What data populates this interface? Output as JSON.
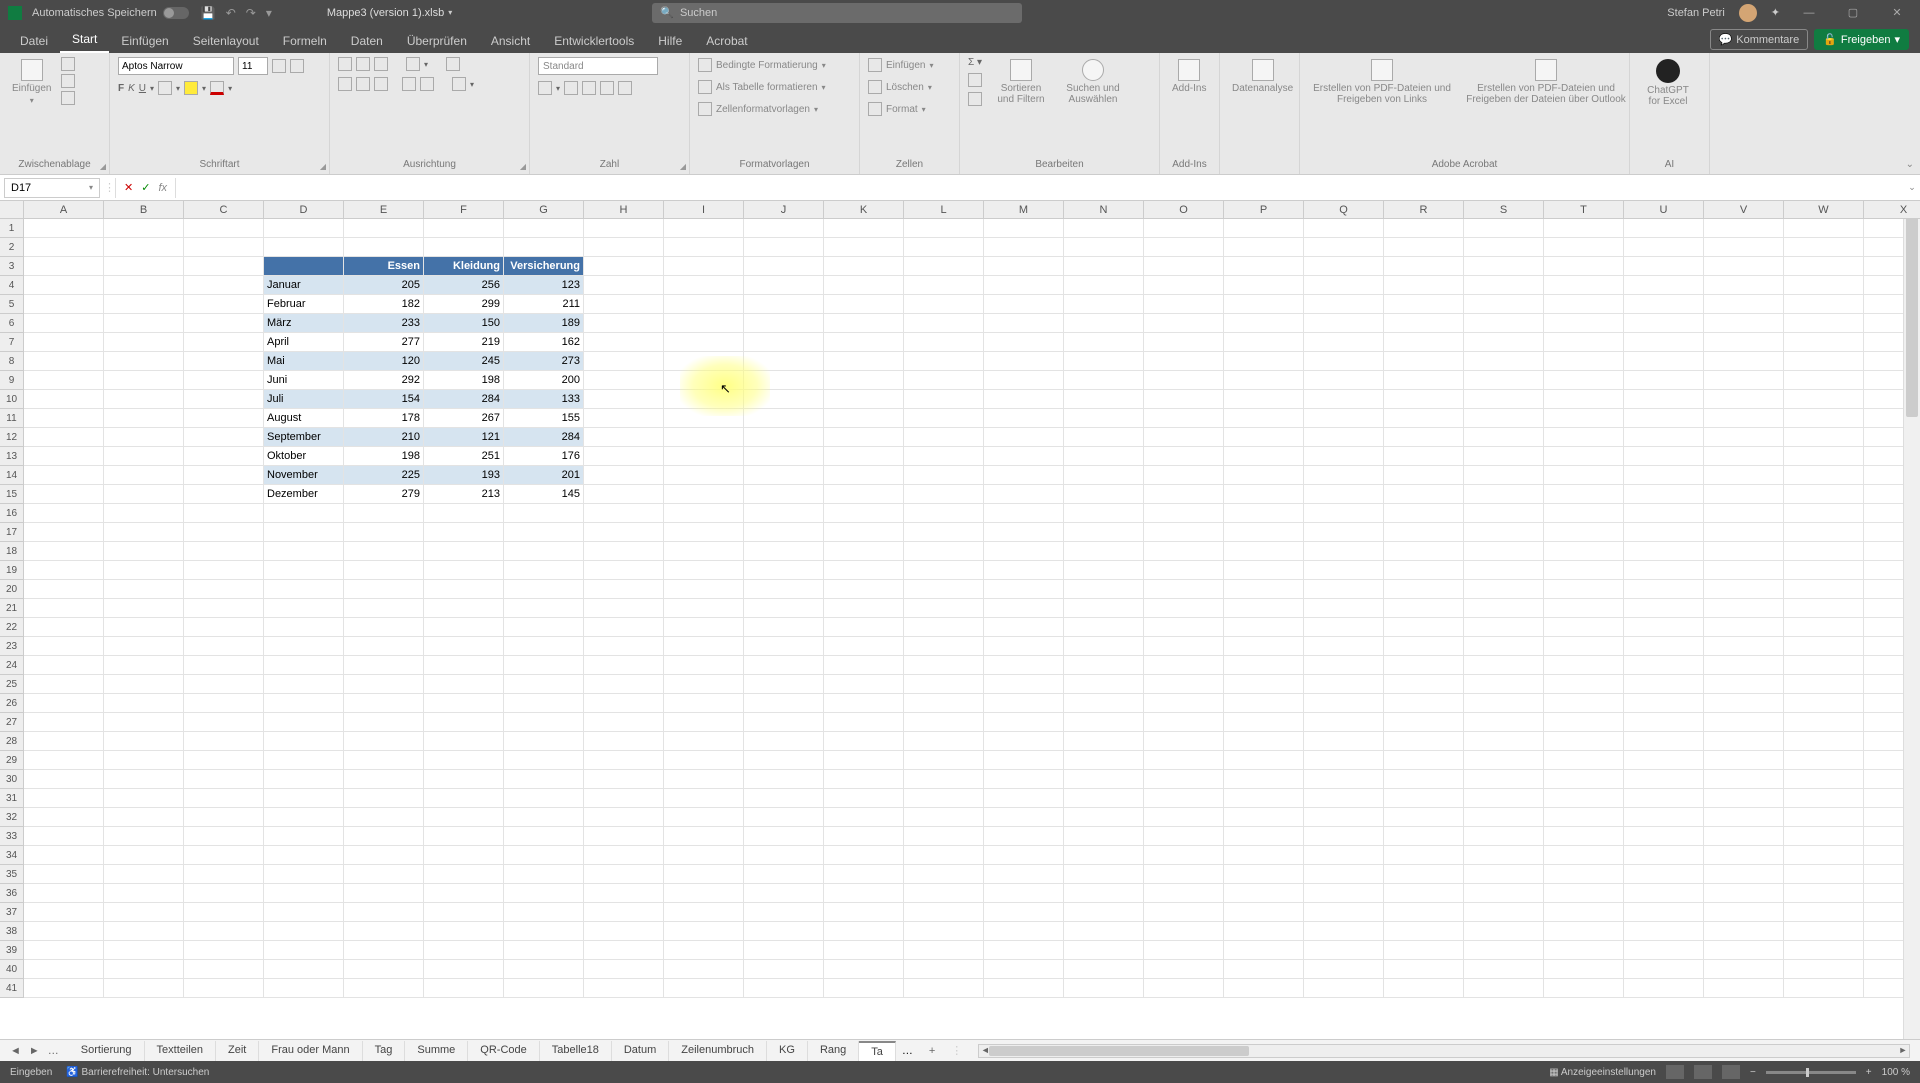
{
  "titlebar": {
    "autosave_label": "Automatisches Speichern",
    "filename": "Mappe3 (version 1).xlsb",
    "search_placeholder": "Suchen",
    "user": "Stefan Petri"
  },
  "tabs": [
    "Datei",
    "Start",
    "Einfügen",
    "Seitenlayout",
    "Formeln",
    "Daten",
    "Überprüfen",
    "Ansicht",
    "Entwicklertools",
    "Hilfe",
    "Acrobat"
  ],
  "tabs_active": "Start",
  "rbtn_comments": "Kommentare",
  "rbtn_share": "Freigeben",
  "ribbon": {
    "clipboard": {
      "paste": "Einfügen",
      "group": "Zwischenablage"
    },
    "font": {
      "name": "Aptos Narrow",
      "size": "11",
      "group": "Schriftart",
      "b": "F",
      "i": "K",
      "u": "U"
    },
    "align": {
      "group": "Ausrichtung"
    },
    "number": {
      "format": "Standard",
      "group": "Zahl"
    },
    "styles": {
      "cond": "Bedingte Formatierung",
      "table": "Als Tabelle formatieren",
      "cell": "Zellenformatvorlagen",
      "group": "Formatvorlagen"
    },
    "cells": {
      "insert": "Einfügen",
      "delete": "Löschen",
      "format": "Format",
      "group": "Zellen"
    },
    "editing": {
      "sort": "Sortieren und Filtern",
      "find": "Suchen und Auswählen",
      "group": "Bearbeiten"
    },
    "addins": {
      "addins": "Add-Ins",
      "group": "Add-Ins"
    },
    "analysis": {
      "label": "Datenanalyse"
    },
    "acrobat": {
      "pdf1": "Erstellen von PDF-Dateien und Freigeben von Links",
      "pdf2": "Erstellen von PDF-Dateien und Freigeben der Dateien über Outlook",
      "group": "Adobe Acrobat"
    },
    "ai": {
      "gpt": "ChatGPT for Excel",
      "group": "AI"
    }
  },
  "name_box": "D17",
  "chart_data": {
    "type": "table",
    "columns": [
      "",
      "Essen",
      "Kleidung",
      "Versicherung"
    ],
    "rows": [
      [
        "Januar",
        205,
        256,
        123
      ],
      [
        "Februar",
        182,
        299,
        211
      ],
      [
        "März",
        233,
        150,
        189
      ],
      [
        "April",
        277,
        219,
        162
      ],
      [
        "Mai",
        120,
        245,
        273
      ],
      [
        "Juni",
        292,
        198,
        200
      ],
      [
        "Juli",
        154,
        284,
        133
      ],
      [
        "August",
        178,
        267,
        155
      ],
      [
        "September",
        210,
        121,
        284
      ],
      [
        "Oktober",
        198,
        251,
        176
      ],
      [
        "November",
        225,
        193,
        201
      ],
      [
        "Dezember",
        279,
        213,
        145
      ]
    ]
  },
  "col_letters": [
    "A",
    "B",
    "C",
    "D",
    "E",
    "F",
    "G",
    "H",
    "I",
    "J",
    "K",
    "L",
    "M",
    "N",
    "O",
    "P",
    "Q",
    "R",
    "S",
    "T",
    "U",
    "V",
    "W",
    "X"
  ],
  "row_count": 41,
  "sheet_tabs": [
    "Sortierung",
    "Textteilen",
    "Zeit",
    "Frau oder Mann",
    "Tag",
    "Summe",
    "QR-Code",
    "Tabelle18",
    "Datum",
    "Zeilenumbruch",
    "KG",
    "Rang",
    "Ta"
  ],
  "sheet_active": "Ta",
  "more_tabs": "…",
  "status": {
    "mode": "Eingeben",
    "acc": "Barrierefreiheit: Untersuchen",
    "display": "Anzeigeeinstellungen",
    "zoom": "100 %"
  }
}
